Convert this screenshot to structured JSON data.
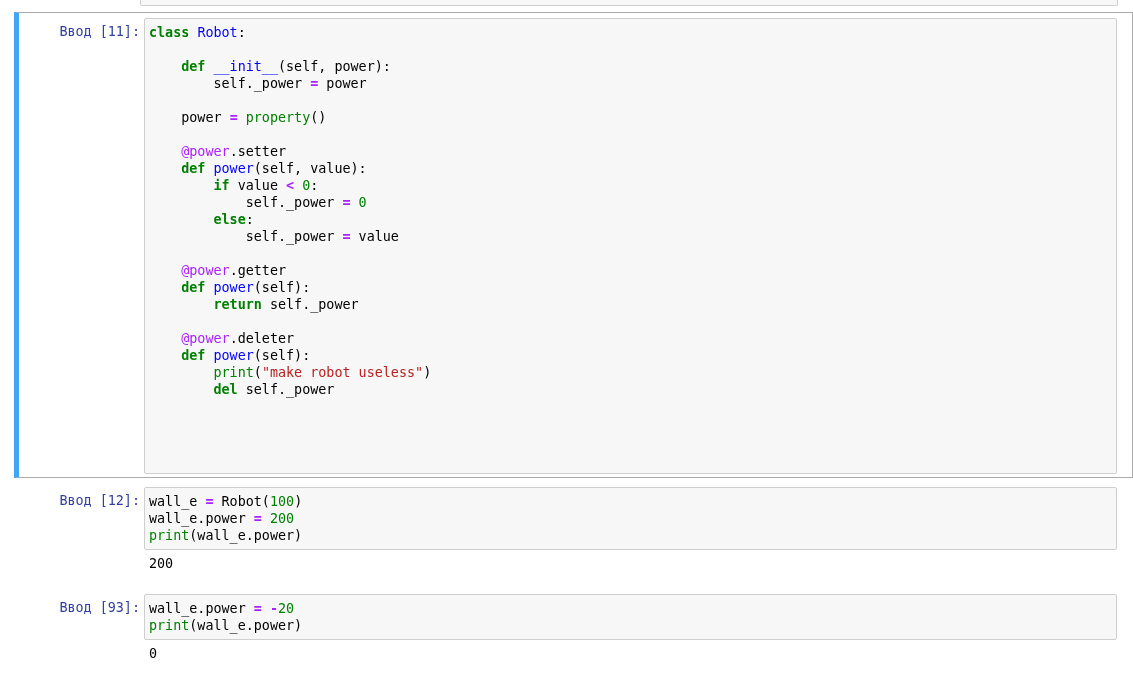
{
  "cells": [
    {
      "prompt": "Ввод [11]:",
      "selected": true,
      "lines": [
        {
          "tokens": [
            {
              "text": "class ",
              "kind": "kw"
            },
            {
              "text": "Robot",
              "kind": "name"
            },
            {
              "text": ":",
              "kind": "p"
            }
          ]
        },
        {
          "blank_before": true,
          "tokens": [
            {
              "text": "    def ",
              "kind": "kw"
            },
            {
              "text": "__init__",
              "kind": "name"
            },
            {
              "text": "(self, power):",
              "kind": "p"
            }
          ]
        },
        {
          "tokens": [
            {
              "text": "        self._power ",
              "kind": "p"
            },
            {
              "text": "=",
              "kind": "op"
            },
            {
              "text": " power",
              "kind": "p"
            }
          ]
        },
        {
          "blank_before": true,
          "tokens": [
            {
              "text": "    power ",
              "kind": "p"
            },
            {
              "text": "=",
              "kind": "op"
            },
            {
              "text": " property",
              "kind": "builtin"
            },
            {
              "text": "()",
              "kind": "p"
            }
          ]
        },
        {
          "blank_before": true,
          "tokens": [
            {
              "text": "    @power",
              "kind": "deco"
            },
            {
              "text": ".setter",
              "kind": "p"
            }
          ]
        },
        {
          "tokens": [
            {
              "text": "    def ",
              "kind": "kw"
            },
            {
              "text": "power",
              "kind": "name"
            },
            {
              "text": "(self, value):",
              "kind": "p"
            }
          ]
        },
        {
          "tokens": [
            {
              "text": "        if",
              "kind": "kw"
            },
            {
              "text": " value ",
              "kind": "p"
            },
            {
              "text": "<",
              "kind": "op"
            },
            {
              "text": " 0",
              "kind": "num"
            },
            {
              "text": ":",
              "kind": "p"
            }
          ]
        },
        {
          "tokens": [
            {
              "text": "            self._power ",
              "kind": "p"
            },
            {
              "text": "=",
              "kind": "op"
            },
            {
              "text": " 0",
              "kind": "num"
            }
          ]
        },
        {
          "tokens": [
            {
              "text": "        else",
              "kind": "kw"
            },
            {
              "text": ":",
              "kind": "p"
            }
          ]
        },
        {
          "tokens": [
            {
              "text": "            self._power ",
              "kind": "p"
            },
            {
              "text": "=",
              "kind": "op"
            },
            {
              "text": " value",
              "kind": "p"
            }
          ]
        },
        {
          "blank_before": true,
          "tokens": [
            {
              "text": "    @power",
              "kind": "deco"
            },
            {
              "text": ".getter",
              "kind": "p"
            }
          ]
        },
        {
          "tokens": [
            {
              "text": "    def ",
              "kind": "kw"
            },
            {
              "text": "power",
              "kind": "name"
            },
            {
              "text": "(self):",
              "kind": "p"
            }
          ]
        },
        {
          "tokens": [
            {
              "text": "        return",
              "kind": "kw"
            },
            {
              "text": " self._power",
              "kind": "p"
            }
          ]
        },
        {
          "blank_before": true,
          "tokens": [
            {
              "text": "    @power",
              "kind": "deco"
            },
            {
              "text": ".deleter",
              "kind": "p"
            }
          ]
        },
        {
          "tokens": [
            {
              "text": "    def ",
              "kind": "kw"
            },
            {
              "text": "power",
              "kind": "name"
            },
            {
              "text": "(self):",
              "kind": "p"
            }
          ]
        },
        {
          "tokens": [
            {
              "text": "        print",
              "kind": "builtin"
            },
            {
              "text": "(",
              "kind": "p"
            },
            {
              "text": "\"make robot useless\"",
              "kind": "str"
            },
            {
              "text": ")",
              "kind": "p"
            }
          ]
        },
        {
          "tokens": [
            {
              "text": "        del",
              "kind": "kw"
            },
            {
              "text": " self._power",
              "kind": "p"
            }
          ]
        }
      ]
    },
    {
      "prompt": "Ввод [12]:",
      "selected": false,
      "lines": [
        {
          "tokens": [
            {
              "text": "wall_e ",
              "kind": "p"
            },
            {
              "text": "=",
              "kind": "op"
            },
            {
              "text": " Robot(",
              "kind": "p"
            },
            {
              "text": "100",
              "kind": "num"
            },
            {
              "text": ")",
              "kind": "p"
            }
          ]
        },
        {
          "tokens": [
            {
              "text": "wall_e.power ",
              "kind": "p"
            },
            {
              "text": "=",
              "kind": "op"
            },
            {
              "text": " 200",
              "kind": "num"
            }
          ]
        },
        {
          "tokens": [
            {
              "text": "print",
              "kind": "builtin"
            },
            {
              "text": "(wall_e.power)",
              "kind": "p"
            }
          ]
        }
      ],
      "output": "200"
    },
    {
      "prompt": "Ввод [93]:",
      "selected": false,
      "lines": [
        {
          "tokens": [
            {
              "text": "wall_e.power ",
              "kind": "p"
            },
            {
              "text": "= -",
              "kind": "op"
            },
            {
              "text": "20",
              "kind": "num"
            }
          ]
        },
        {
          "tokens": [
            {
              "text": "print",
              "kind": "builtin"
            },
            {
              "text": "(wall_e.power)",
              "kind": "p"
            }
          ]
        }
      ],
      "output": "0"
    }
  ]
}
